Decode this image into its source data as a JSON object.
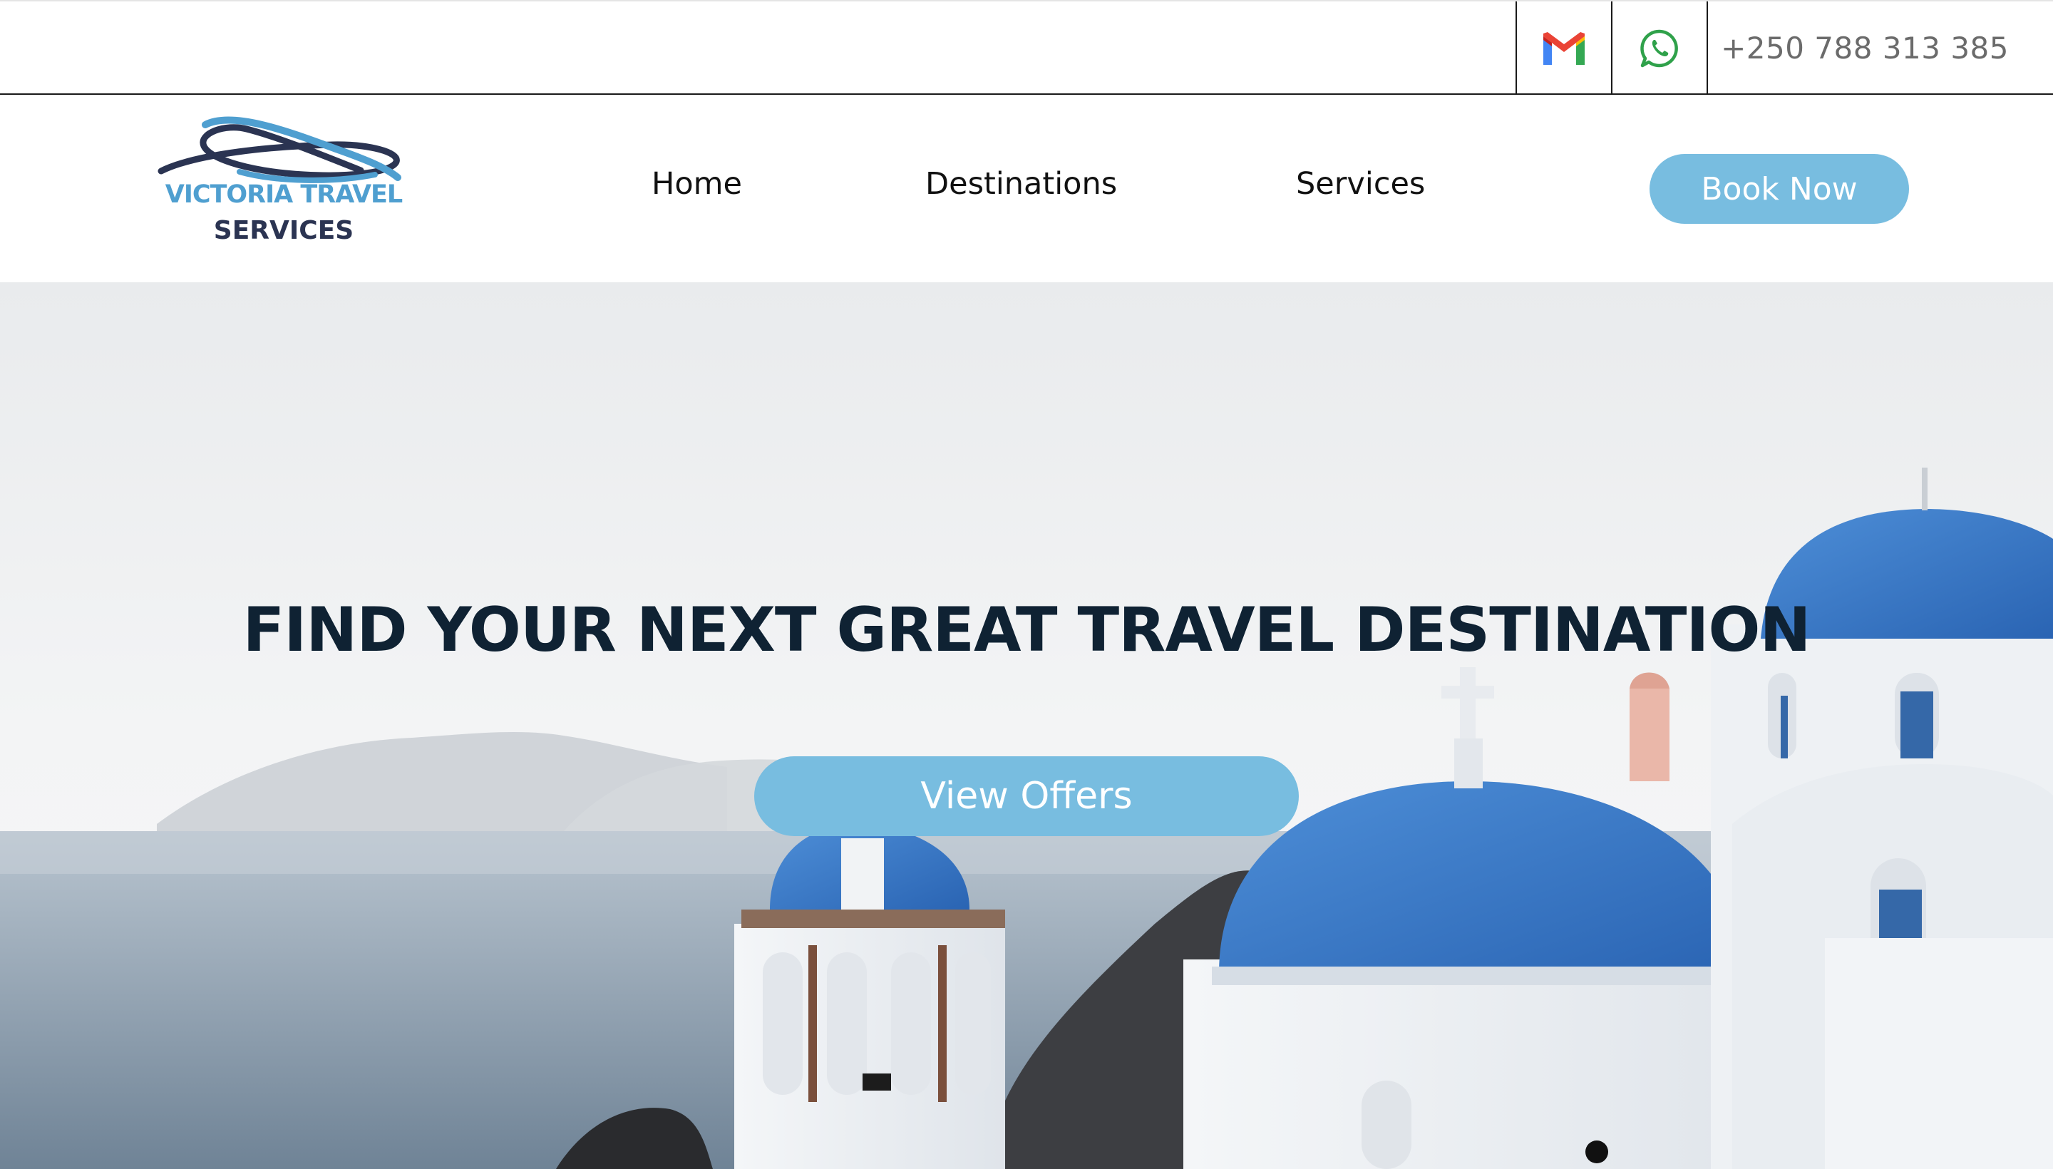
{
  "topbar": {
    "gmail_icon": "gmail-icon",
    "whatsapp_icon": "whatsapp-icon",
    "phone": "+250 788 313 385"
  },
  "header": {
    "logo": {
      "line1": "VICTORIA TRAVEL",
      "line2": "SERVICES"
    },
    "nav": [
      {
        "label": "Home"
      },
      {
        "label": "Destinations"
      },
      {
        "label": "Services"
      }
    ],
    "book_label": "Book Now"
  },
  "hero": {
    "title": "FIND YOUR NEXT GREAT TRAVEL DESTINATION",
    "cta_label": "View Offers"
  },
  "colors": {
    "accent": "#78bde0",
    "title": "#0f2233",
    "logo_blue": "#4f9fd0",
    "logo_navy": "#2b3452",
    "dome_blue": "#2f6fbf"
  }
}
